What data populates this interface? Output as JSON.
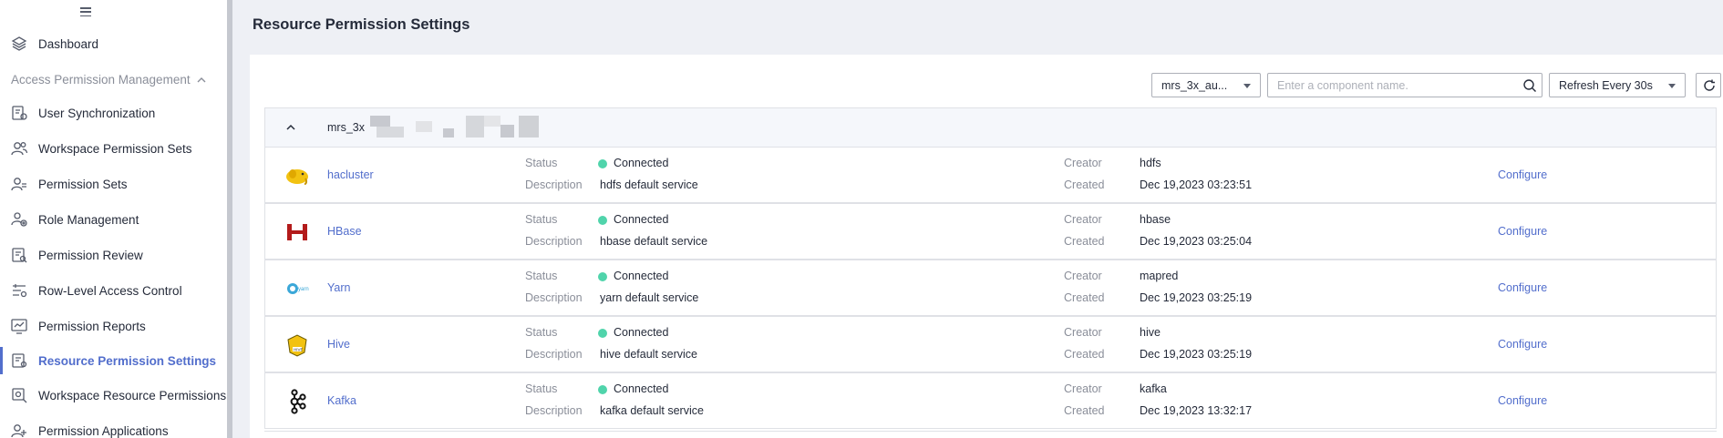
{
  "sidebar": {
    "top": [
      {
        "label": "Dashboard",
        "icon": "layers-icon"
      }
    ],
    "group": {
      "label": "Access Permission Management",
      "expanded": true
    },
    "items": [
      {
        "label": "User Synchronization",
        "icon": "user-sync-icon"
      },
      {
        "label": "Workspace Permission Sets",
        "icon": "users-icon"
      },
      {
        "label": "Permission Sets",
        "icon": "user-group-icon"
      },
      {
        "label": "Role Management",
        "icon": "role-icon"
      },
      {
        "label": "Permission Review",
        "icon": "review-icon"
      },
      {
        "label": "Row-Level Access Control",
        "icon": "filter-icon"
      },
      {
        "label": "Permission Reports",
        "icon": "report-icon"
      },
      {
        "label": "Resource Permission Settings",
        "icon": "resource-settings-icon",
        "active": true
      },
      {
        "label": "Workspace Resource Permissions",
        "icon": "workspace-resource-icon"
      },
      {
        "label": "Permission Applications",
        "icon": "application-icon"
      }
    ]
  },
  "page": {
    "title": "Resource Permission Settings"
  },
  "toolbar": {
    "cluster_select": "mrs_3x_au...",
    "search_placeholder": "Enter a component name.",
    "refresh_select": "Refresh Every 30s"
  },
  "cluster": {
    "name": "mrs_3x"
  },
  "labels": {
    "status": "Status",
    "description": "Description",
    "creator": "Creator",
    "created": "Created",
    "configure": "Configure"
  },
  "services": [
    {
      "name": "hacluster",
      "logo": "hadoop-elephant-icon",
      "status": "Connected",
      "description": "hdfs default service",
      "creator": "hdfs",
      "created": "Dec 19,2023 03:23:51"
    },
    {
      "name": "HBase",
      "logo": "hbase-icon",
      "status": "Connected",
      "description": "hbase default service",
      "creator": "hbase",
      "created": "Dec 19,2023 03:25:04"
    },
    {
      "name": "Yarn",
      "logo": "yarn-icon",
      "status": "Connected",
      "description": "yarn default service",
      "creator": "mapred",
      "created": "Dec 19,2023 03:25:19"
    },
    {
      "name": "Hive",
      "logo": "hive-icon",
      "status": "Connected",
      "description": "hive default service",
      "creator": "hive",
      "created": "Dec 19,2023 03:25:19"
    },
    {
      "name": "Kafka",
      "logo": "kafka-icon",
      "status": "Connected",
      "description": "kafka default service",
      "creator": "kafka",
      "created": "Dec 19,2023 13:32:17"
    }
  ],
  "colors": {
    "accent": "#526ecc",
    "connected": "#50d4ab",
    "muted": "#8a8e99"
  }
}
